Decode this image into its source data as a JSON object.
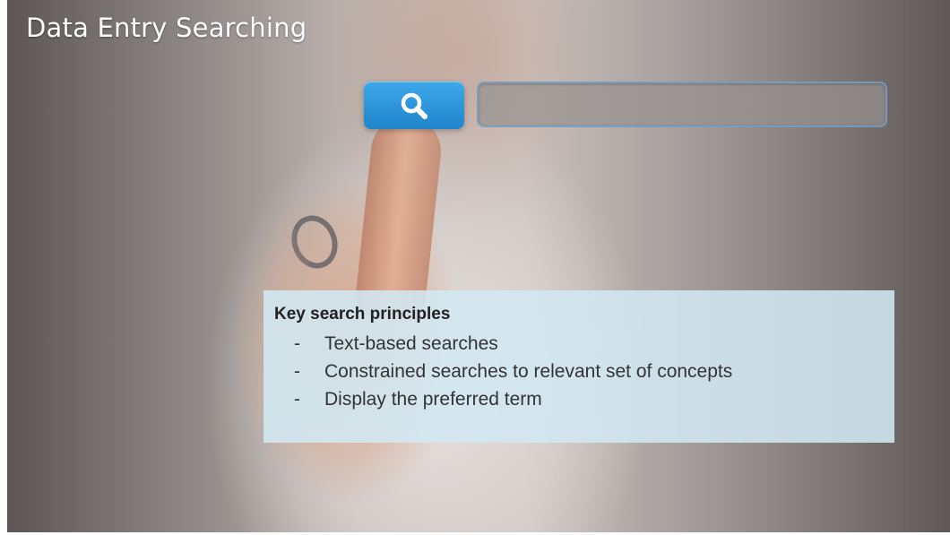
{
  "slide": {
    "title": "Data Entry Searching"
  },
  "search": {
    "button_icon": "search-icon",
    "input_value": "",
    "accent_color": "#2b95dc"
  },
  "principles": {
    "heading": "Key search principles",
    "bullet_marker": "-",
    "items": [
      "Text-based searches",
      "Constrained searches to relevant set of concepts",
      "Display the preferred term"
    ]
  }
}
